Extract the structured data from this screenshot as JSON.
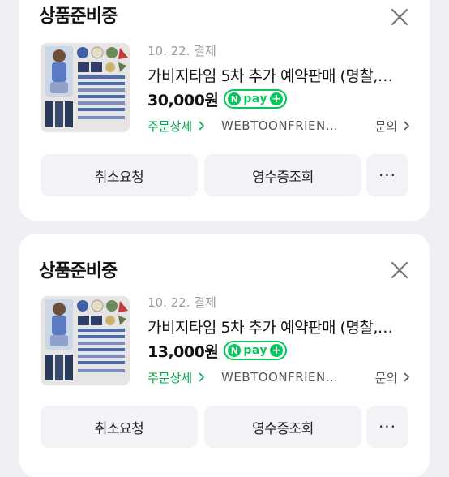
{
  "orders": [
    {
      "status": "상품준비중",
      "date": "10. 22. 결제",
      "product_name": "가비지타임 5차 추가 예약판매 (명찰,…",
      "price": "30,000원",
      "npay_label": "pay",
      "detail_link": "주문상세",
      "seller": "WEBTOONFRIEN…",
      "inquiry": "문의",
      "buttons": {
        "cancel": "취소요청",
        "receipt": "영수증조회",
        "more": "···"
      }
    },
    {
      "status": "상품준비중",
      "date": "10. 22. 결제",
      "product_name": "가비지타임 5차 추가 예약판매 (명찰,…",
      "price": "13,000원",
      "npay_label": "pay",
      "detail_link": "주문상세",
      "seller": "WEBTOONFRIEN…",
      "inquiry": "문의",
      "buttons": {
        "cancel": "취소요청",
        "receipt": "영수증조회",
        "more": "···"
      }
    }
  ],
  "icons": {
    "close": "close-icon",
    "chevron": "chevron-right-icon",
    "npay_n": "N",
    "npay_plus": "+"
  },
  "colors": {
    "page_bg": "#eef0f3",
    "card_bg": "#ffffff",
    "naver_green": "#03c75a",
    "link_green": "#03a94c",
    "button_bg": "#f2f3f6"
  }
}
